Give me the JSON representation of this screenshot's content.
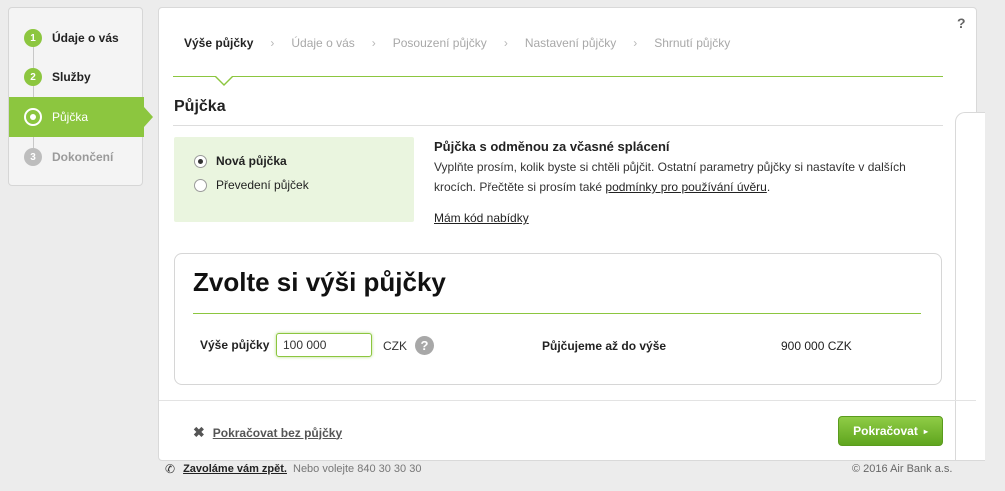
{
  "sidebar": {
    "items": [
      {
        "num": "1",
        "label": "Údaje o vás",
        "state": "done"
      },
      {
        "num": "2",
        "label": "Služby",
        "state": "done"
      },
      {
        "num": "",
        "label": "Půjčka",
        "state": "active"
      },
      {
        "num": "3",
        "label": "Dokončení",
        "state": "todo"
      }
    ]
  },
  "help_icon": "?",
  "steps": [
    "Výše půjčky",
    "Údaje o vás",
    "Posouzení půjčky",
    "Nastavení půjčky",
    "Shrnutí půjčky"
  ],
  "step_separator": "›",
  "section_title": "Půjčka",
  "options": {
    "new_loan": "Nová půjčka",
    "transfer": "Převedení půjček",
    "selected": "new_loan"
  },
  "promo": {
    "title": "Půjčka s odměnou za včasné splácení",
    "text_before": "Vyplňte prosím, kolik byste si chtěli půjčit. Ostatní parametry půjčky si nastavíte v dalších krocích. Přečtěte si prosím také ",
    "terms_link": "podmínky pro používání úvěru",
    "text_after": ".",
    "offer_code_link": "Mám kód nabídky"
  },
  "amount": {
    "title": "Zvolte si výši půjčky",
    "label": "Výše půjčky",
    "value": "100 000",
    "currency": "CZK",
    "help": "?",
    "max_label": "Půjčujeme až do výše",
    "max_value": "900 000 CZK"
  },
  "footer": {
    "skip_icon": "close-icon",
    "skip_label": "Pokračovat bez půjčky",
    "continue_label": "Pokračovat",
    "continue_arrow": "▸"
  },
  "bottom": {
    "callback_label": "Zavoláme vám zpět.",
    "call_text": "Nebo volejte 840 30 30 30",
    "copyright": "© 2016 Air Bank a.s."
  },
  "colors": {
    "accent": "#8cc63f",
    "box_bg": "#eaf5df"
  }
}
